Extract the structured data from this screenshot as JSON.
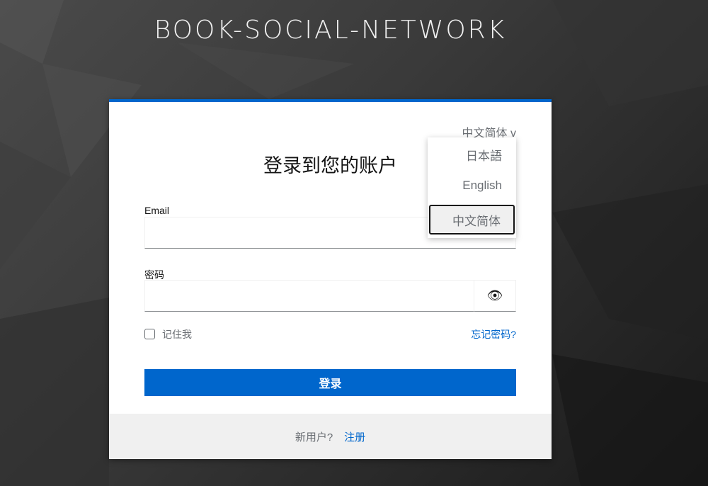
{
  "brand": "BOOK-SOCIAL-NETWORK",
  "language_selector": {
    "current": "中文简体 v",
    "options": [
      "日本語",
      "English",
      "中文简体"
    ],
    "selected": "中文简体"
  },
  "login": {
    "title": "登录到您的账户",
    "email_label": "Email",
    "email_value": "",
    "password_label": "密码",
    "password_value": "",
    "show_password_icon": "eye-icon",
    "remember_me": "记住我",
    "remember_checked": false,
    "forgot_password": "忘记密码?",
    "submit": "登录"
  },
  "footer": {
    "new_user": "新用户?",
    "register": "注册"
  },
  "colors": {
    "primary": "#0066cc",
    "footer_bg": "#f0f0f0"
  }
}
